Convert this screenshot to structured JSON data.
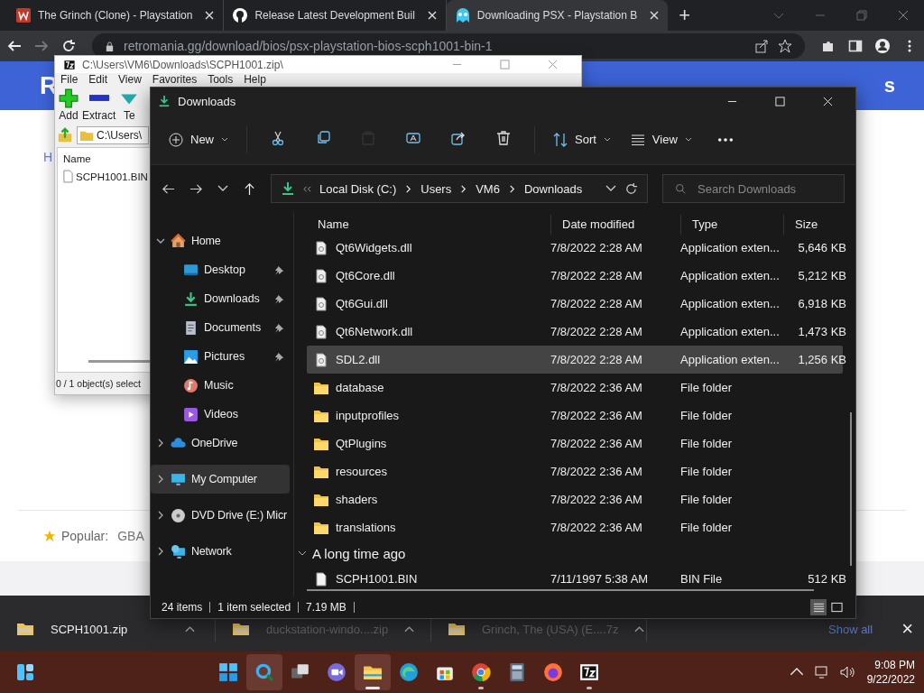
{
  "browser": {
    "tabs": [
      {
        "title": "The Grinch (Clone) - Playstation",
        "selected": false
      },
      {
        "title": "Release Latest Development Buil",
        "selected": false
      },
      {
        "title": "Downloading PSX - Playstation B",
        "selected": true
      }
    ],
    "new_tab": "+",
    "url": "retromania.gg/download/bios/psx-playstation-bios-scph1001-bin-1"
  },
  "page": {
    "banner_left": "R",
    "banner_right": "s",
    "link": "H",
    "popular_label": "Popular:",
    "popular_items": [
      "GBA"
    ]
  },
  "downloads_bar": {
    "items": [
      {
        "name": "SCPH1001.zip",
        "dimmed": false
      },
      {
        "name": "duckstation-windo....zip",
        "dimmed": true
      },
      {
        "name": "Grinch, The (USA) (E....7z",
        "dimmed": true
      }
    ],
    "show_all": "Show all",
    "close": "×"
  },
  "archive_window": {
    "title": "C:\\Users\\VM6\\Downloads\\SCPH1001.zip\\",
    "menu": [
      "File",
      "Edit",
      "View",
      "Favorites",
      "Tools",
      "Help"
    ],
    "tools": [
      "Add",
      "Extract",
      "Te"
    ],
    "path": "C:\\Users\\",
    "column": "Name",
    "files": [
      "SCPH1001.BIN"
    ],
    "status": "0 / 1 object(s) select"
  },
  "explorer": {
    "title": "Downloads",
    "new_button": "New",
    "sort_button": "Sort",
    "view_button": "View",
    "tools": [
      {
        "disabled": false
      },
      {
        "disabled": false
      },
      {
        "disabled": true
      },
      {
        "disabled": false
      },
      {
        "disabled": false
      },
      {
        "disabled": false
      }
    ],
    "path": [
      "Local Disk (C:)",
      "Users",
      "VM6",
      "Downloads"
    ],
    "search": {
      "placeholder": "Search Downloads"
    },
    "nav": [
      {
        "label": "Home",
        "expanded": true,
        "selected": false,
        "children": [
          {
            "label": "Desktop",
            "pinned": true
          },
          {
            "label": "Downloads",
            "pinned": true
          },
          {
            "label": "Documents",
            "pinned": true
          },
          {
            "label": "Pictures",
            "pinned": true
          },
          {
            "label": "Music",
            "pinned": false
          },
          {
            "label": "Videos",
            "pinned": false
          }
        ]
      },
      {
        "label": "OneDrive",
        "expanded": false,
        "selected": false
      },
      {
        "label": "My Computer",
        "expanded": false,
        "selected": true
      },
      {
        "label": "DVD Drive (E:) Micr",
        "expanded": false,
        "selected": false
      },
      {
        "label": "Network",
        "expanded": false,
        "selected": false
      }
    ],
    "columns": [
      "Name",
      "Date modified",
      "Type",
      "Size"
    ],
    "groups": [
      {
        "rows": [
          {
            "kind": "file",
            "name": "Qt6Widgets.dll",
            "date": "7/8/2022 2:28 AM",
            "type": "Application exten...",
            "size": "5,646 KB",
            "selected": false
          },
          {
            "kind": "file",
            "name": "Qt6Core.dll",
            "date": "7/8/2022 2:28 AM",
            "type": "Application exten...",
            "size": "5,212 KB",
            "selected": false
          },
          {
            "kind": "file",
            "name": "Qt6Gui.dll",
            "date": "7/8/2022 2:28 AM",
            "type": "Application exten...",
            "size": "6,918 KB",
            "selected": false
          },
          {
            "kind": "file",
            "name": "Qt6Network.dll",
            "date": "7/8/2022 2:28 AM",
            "type": "Application exten...",
            "size": "1,473 KB",
            "selected": false
          },
          {
            "kind": "file",
            "name": "SDL2.dll",
            "date": "7/8/2022 2:28 AM",
            "type": "Application exten...",
            "size": "1,256 KB",
            "selected": true
          },
          {
            "kind": "folder",
            "name": "database",
            "date": "7/8/2022 2:36 AM",
            "type": "File folder",
            "selected": false
          },
          {
            "kind": "folder",
            "name": "inputprofiles",
            "date": "7/8/2022 2:36 AM",
            "type": "File folder",
            "selected": false
          },
          {
            "kind": "folder",
            "name": "QtPlugins",
            "date": "7/8/2022 2:36 AM",
            "type": "File folder",
            "selected": false
          },
          {
            "kind": "folder",
            "name": "resources",
            "date": "7/8/2022 2:36 AM",
            "type": "File folder",
            "selected": false
          },
          {
            "kind": "folder",
            "name": "shaders",
            "date": "7/8/2022 2:36 AM",
            "type": "File folder",
            "selected": false
          },
          {
            "kind": "folder",
            "name": "translations",
            "date": "7/8/2022 2:36 AM",
            "type": "File folder",
            "selected": false
          }
        ]
      },
      {
        "title": "A long time ago",
        "expanded": true,
        "rows": [
          {
            "kind": "blank",
            "name": "SCPH1001.BIN",
            "date": "7/11/1997 5:38 AM",
            "type": "BIN File",
            "size": "512 KB",
            "selected": false
          }
        ]
      }
    ],
    "status": {
      "count": "24 items",
      "selection": "1 item selected",
      "size": "7.19 MB"
    },
    "views": [
      {
        "selected": true
      },
      {
        "selected": false
      }
    ]
  },
  "taskbar": {
    "apps": [
      {
        "running": false,
        "active": false
      },
      {
        "running": false,
        "active": true
      },
      {
        "running": false,
        "active": false
      },
      {
        "running": false,
        "active": false
      },
      {
        "running": true,
        "active": true
      },
      {
        "running": false,
        "active": false
      },
      {
        "running": false,
        "active": false
      },
      {
        "running": true,
        "active": false
      },
      {
        "running": false,
        "active": false
      },
      {
        "running": false,
        "active": false
      },
      {
        "running": true,
        "active": false
      }
    ],
    "time": "9:08 PM",
    "date": "9/22/2022"
  }
}
